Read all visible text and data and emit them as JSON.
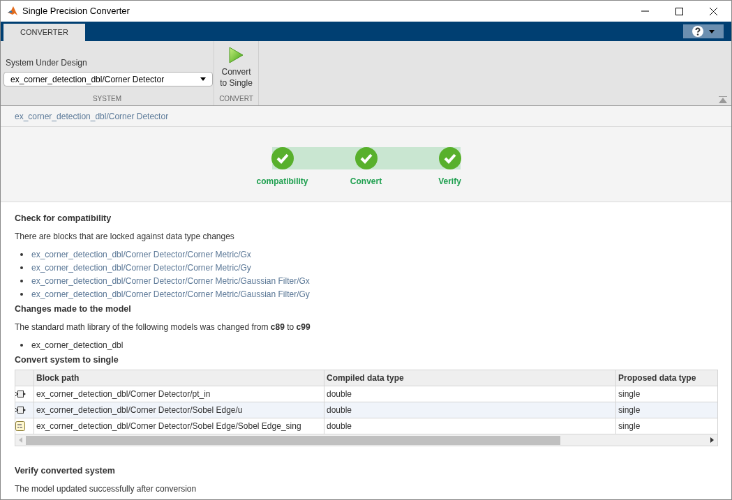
{
  "window": {
    "title": "Single Precision Converter"
  },
  "tabs": [
    {
      "label": "CONVERTER",
      "selected": true
    }
  ],
  "toolstrip": {
    "system_label": "System Under Design",
    "system_value": "ex_corner_detection_dbl/Corner Detector",
    "system_section": "SYSTEM",
    "convert_button": "Convert\nto Single",
    "convert_section": "CONVERT"
  },
  "breadcrumb": "ex_corner_detection_dbl/Corner Detector",
  "steps": [
    {
      "label": "compatibility",
      "done": true
    },
    {
      "label": "Convert",
      "done": true
    },
    {
      "label": "Verify",
      "done": true
    }
  ],
  "sections": [
    {
      "kind": "links",
      "heading": "Check for compatibility",
      "text": "There are blocks that are locked against data type changes",
      "items": [
        "ex_corner_detection_dbl/Corner Detector/Corner Metric/Gx",
        "ex_corner_detection_dbl/Corner Detector/Corner Metric/Gy",
        "ex_corner_detection_dbl/Corner Detector/Corner Metric/Gaussian Filter/Gx",
        "ex_corner_detection_dbl/Corner Detector/Corner Metric/Gaussian Filter/Gy"
      ]
    },
    {
      "kind": "plain",
      "heading": "Changes made to the model",
      "text": "The standard math library of the following models was changed from **c89** to **c99**",
      "items": [
        "ex_corner_detection_dbl"
      ]
    },
    {
      "kind": "table",
      "heading": "Convert system to single",
      "columns": [
        "Block path",
        "Compiled data type",
        "Proposed data type"
      ],
      "rows": [
        {
          "kind": "port",
          "cells": [
            "ex_corner_detection_dbl/Corner Detector/pt_in",
            "double",
            "single"
          ],
          "selected": false
        },
        {
          "kind": "port",
          "cells": [
            "ex_corner_detection_dbl/Corner Detector/Sobel Edge/u",
            "double",
            "single"
          ],
          "selected": true
        },
        {
          "kind": "binary",
          "cells": [
            "ex_corner_detection_dbl/Corner Detector/Sobel Edge/Sobel Edge_sing",
            "double",
            "single"
          ],
          "selected": false
        }
      ]
    },
    {
      "kind": "plain",
      "heading": "Verify converted system",
      "text": "The model updated successfully after conversion"
    }
  ]
}
